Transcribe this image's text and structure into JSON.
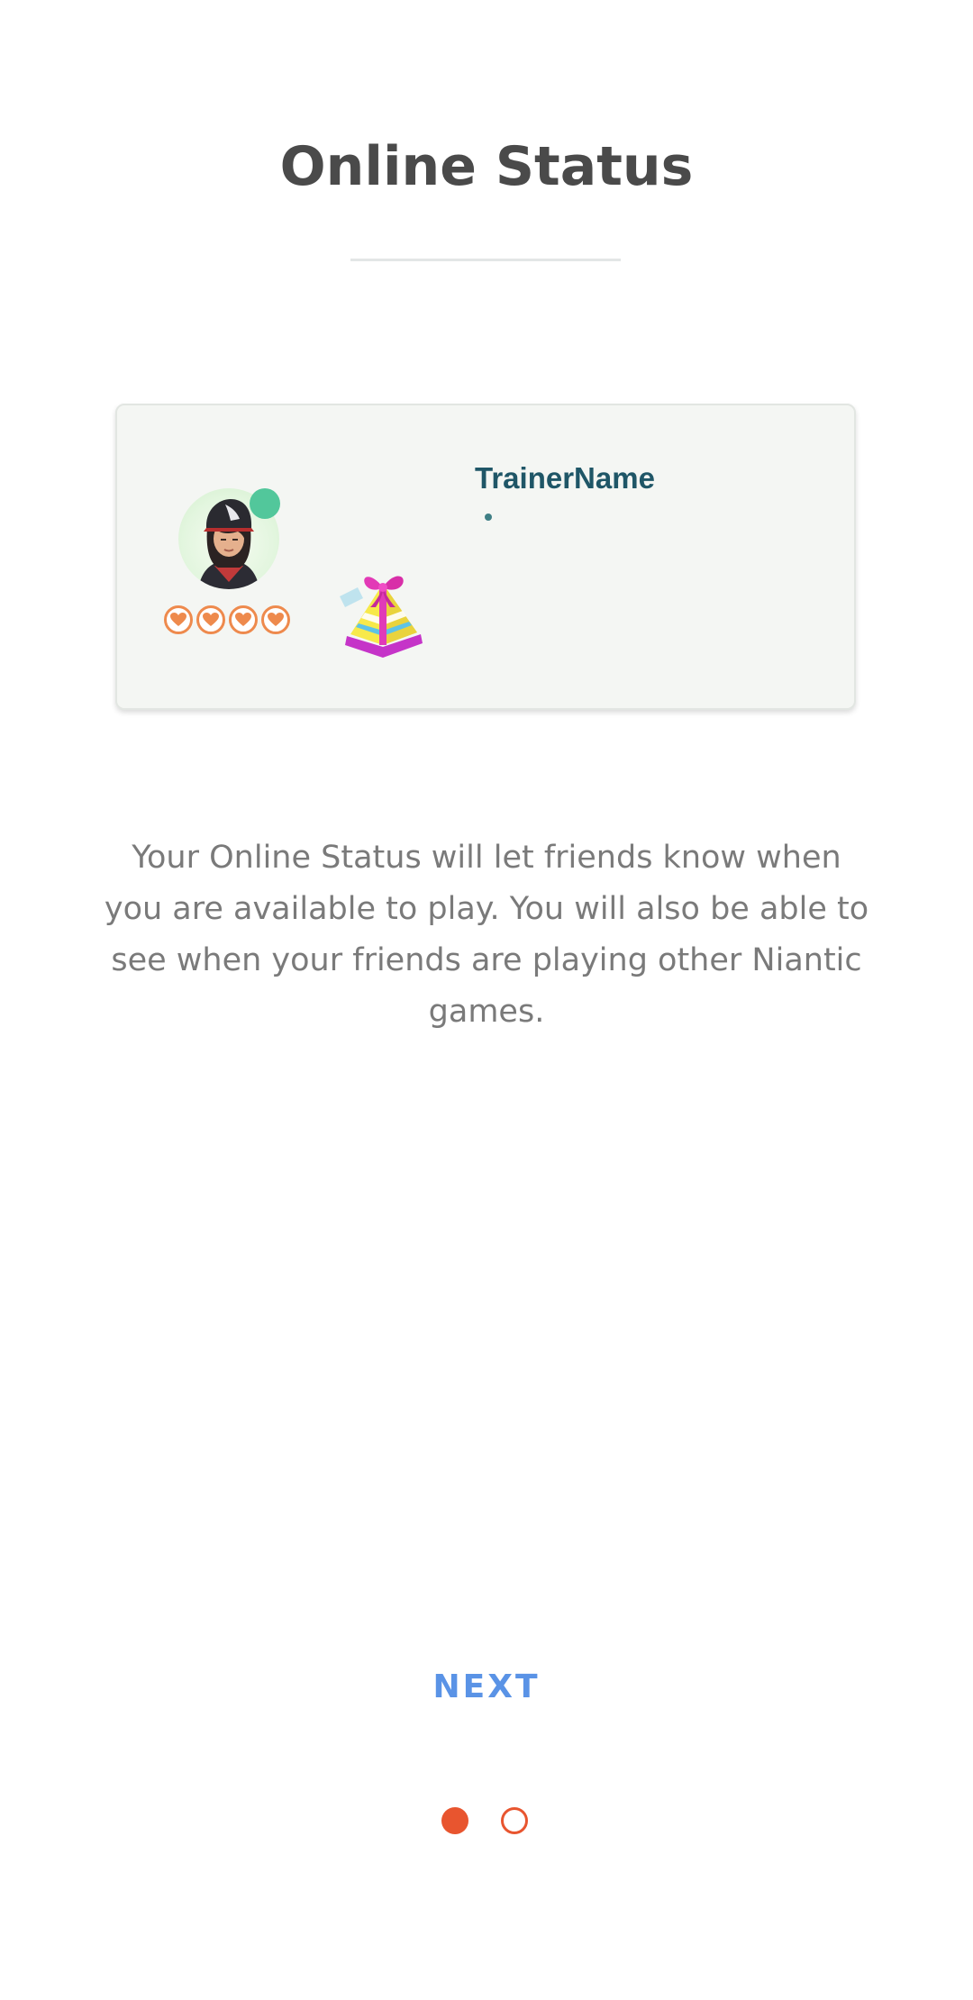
{
  "page": {
    "title": "Online Status"
  },
  "card": {
    "trainer_name": "TrainerName",
    "avatar_icon": "trainer-avatar-icon",
    "online_indicator_icon": "online-dot-icon",
    "friendship_hearts_count": 4,
    "friendship_heart_icon": "heart-icon",
    "gift_icon": "gift-icon"
  },
  "description": "Your Online Status will let friends know when you are available to play. You will also be able to see when your friends are playing other Niantic games.",
  "actions": {
    "next_label": "NEXT"
  },
  "pager": {
    "total_pages": 2,
    "current_page": 1
  },
  "colors": {
    "accent": "#e8552f",
    "next_blue": "#5a93e6",
    "online_green": "#52c79b",
    "trainer_name": "#1f5667",
    "heart_orange": "#ee8a4d"
  }
}
